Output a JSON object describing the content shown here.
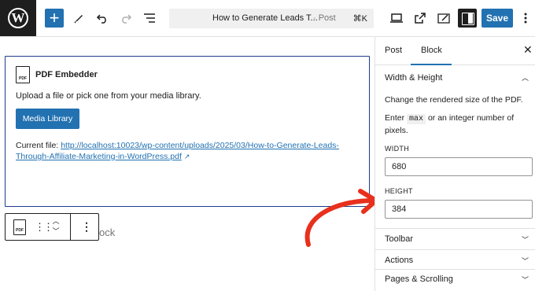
{
  "topbar": {
    "logo_text": "W",
    "add_icon": "plus-icon",
    "doc_title": "How to Generate Leads T...",
    "doc_type": "· Post",
    "shortcut": "⌘K",
    "save_label": "Save"
  },
  "block": {
    "title": "PDF Embedder",
    "icon_text": "PDF",
    "description": "Upload a file or pick one from your media library.",
    "media_button": "Media Library",
    "current_file_label": "Current file: ",
    "current_file_url": "http://localhost:10023/wp-content/uploads/2025/03/How-to-Generate-Leads-Through-Affiliate-Marketing-in-WordPress.pdf",
    "placeholder_tail": "ock"
  },
  "sidebar": {
    "tabs": [
      "Post",
      "Block"
    ],
    "active_tab": "Block",
    "width_height": {
      "title": "Width & Height",
      "help": "Change the rendered size of the PDF.",
      "enter_prefix": "Enter",
      "code": "max",
      "enter_suffix": "or an integer number of pixels.",
      "width_label": "WIDTH",
      "width_value": "680",
      "height_label": "HEIGHT",
      "height_value": "384"
    },
    "panels": [
      "Toolbar",
      "Actions",
      "Pages & Scrolling"
    ]
  },
  "colors": {
    "accent": "#2271b1",
    "arrow": "#e8301c",
    "block_border": "#1d3c8a"
  }
}
